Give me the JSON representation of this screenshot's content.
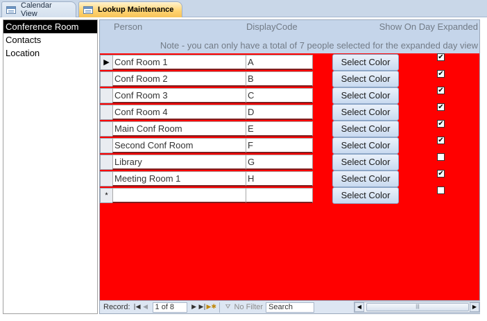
{
  "tabs": [
    {
      "label": "Calendar View",
      "active": false
    },
    {
      "label": "Lookup Maintenance",
      "active": true
    }
  ],
  "leftlist": {
    "items": [
      {
        "label": "Conference Room",
        "selected": true
      },
      {
        "label": "Contacts",
        "selected": false
      },
      {
        "label": "Location",
        "selected": false
      }
    ]
  },
  "header": {
    "person": "Person",
    "display_code": "DisplayCode",
    "show_expanded": "Show On Day Expanded",
    "note": "Note - you can only have a total of 7 people selected for the expanded day view"
  },
  "rows": [
    {
      "selector": "▶",
      "person": "Conf Room 1",
      "code": "A",
      "button": "Select Color",
      "checked": true
    },
    {
      "selector": "",
      "person": "Conf Room 2",
      "code": "B",
      "button": "Select Color",
      "checked": true
    },
    {
      "selector": "",
      "person": "Conf Room 3",
      "code": "C",
      "button": "Select Color",
      "checked": true
    },
    {
      "selector": "",
      "person": "Conf Room 4",
      "code": "D",
      "button": "Select Color",
      "checked": true
    },
    {
      "selector": "",
      "person": "Main Conf Room",
      "code": "E",
      "button": "Select Color",
      "checked": true
    },
    {
      "selector": "",
      "person": "Second Conf Room",
      "code": "F",
      "button": "Select Color",
      "checked": true
    },
    {
      "selector": "",
      "person": "Library",
      "code": "G",
      "button": "Select Color",
      "checked": false
    },
    {
      "selector": "",
      "person": "Meeting Room 1",
      "code": "H",
      "button": "Select Color",
      "checked": true
    },
    {
      "selector": "*",
      "person": "",
      "code": "",
      "button": "Select Color",
      "checked": false
    }
  ],
  "nav": {
    "record_label": "Record:",
    "record_value": "1 of 8",
    "filter_label": "No Filter",
    "search_label": "Search",
    "first_icon": "first-record-icon",
    "prev_icon": "previous-record-icon",
    "next_icon": "next-record-icon",
    "last_icon": "last-record-icon",
    "new_icon": "new-record-icon"
  },
  "colors": {
    "subform_background": "#ff0000",
    "active_tab": "#ffd36f",
    "header_background": "#c5d5ea"
  }
}
